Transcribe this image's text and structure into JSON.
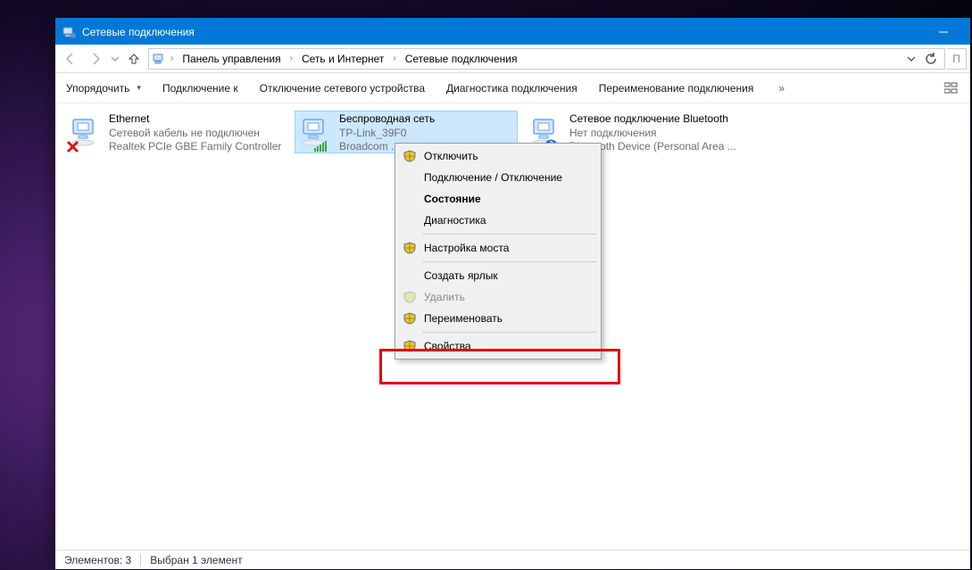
{
  "window": {
    "title": "Сетевые подключения"
  },
  "breadcrumb": {
    "c0": "Панель управления",
    "c1": "Сеть и Интернет",
    "c2": "Сетевые подключения"
  },
  "search": {
    "placeholder": "П"
  },
  "toolbar": {
    "organize": "Упорядочить",
    "connect": "Подключение к",
    "disable": "Отключение сетевого устройства",
    "diag": "Диагностика подключения",
    "rename": "Переименование подключения",
    "more": "»"
  },
  "connections": [
    {
      "name": "Ethernet",
      "sub1": "Сетевой кабель не подключен",
      "sub2": "Realtek PCIe GBE Family Controller",
      "icon": "ethernet",
      "badge": "cross"
    },
    {
      "name": "Беспроводная сеть",
      "sub1": "TP-Link_39F0",
      "sub2": "Broadcom ...",
      "icon": "wifi",
      "badge": "signal",
      "selected": true
    },
    {
      "name": "Сетевое подключение Bluetooth",
      "sub1": "Нет подключения",
      "sub2": "Bluetooth Device (Personal Area ...",
      "icon": "bluetooth",
      "badge": "bt"
    }
  ],
  "context_menu": {
    "items": [
      {
        "label": "Отключить",
        "shield": true
      },
      {
        "label": "Подключение / Отключение"
      },
      {
        "label": "Состояние",
        "bold": true
      },
      {
        "label": "Диагностика"
      },
      {
        "sep": true
      },
      {
        "label": "Настройка моста",
        "shield": true
      },
      {
        "sep": true
      },
      {
        "label": "Создать ярлык"
      },
      {
        "label": "Удалить",
        "shield": true,
        "disabled": true
      },
      {
        "label": "Переименовать",
        "shield": true
      },
      {
        "sep": true
      },
      {
        "label": "Свойства",
        "shield": true,
        "highlighted": true
      }
    ]
  },
  "status": {
    "count": "Элементов: 3",
    "selected": "Выбран 1 элемент"
  }
}
